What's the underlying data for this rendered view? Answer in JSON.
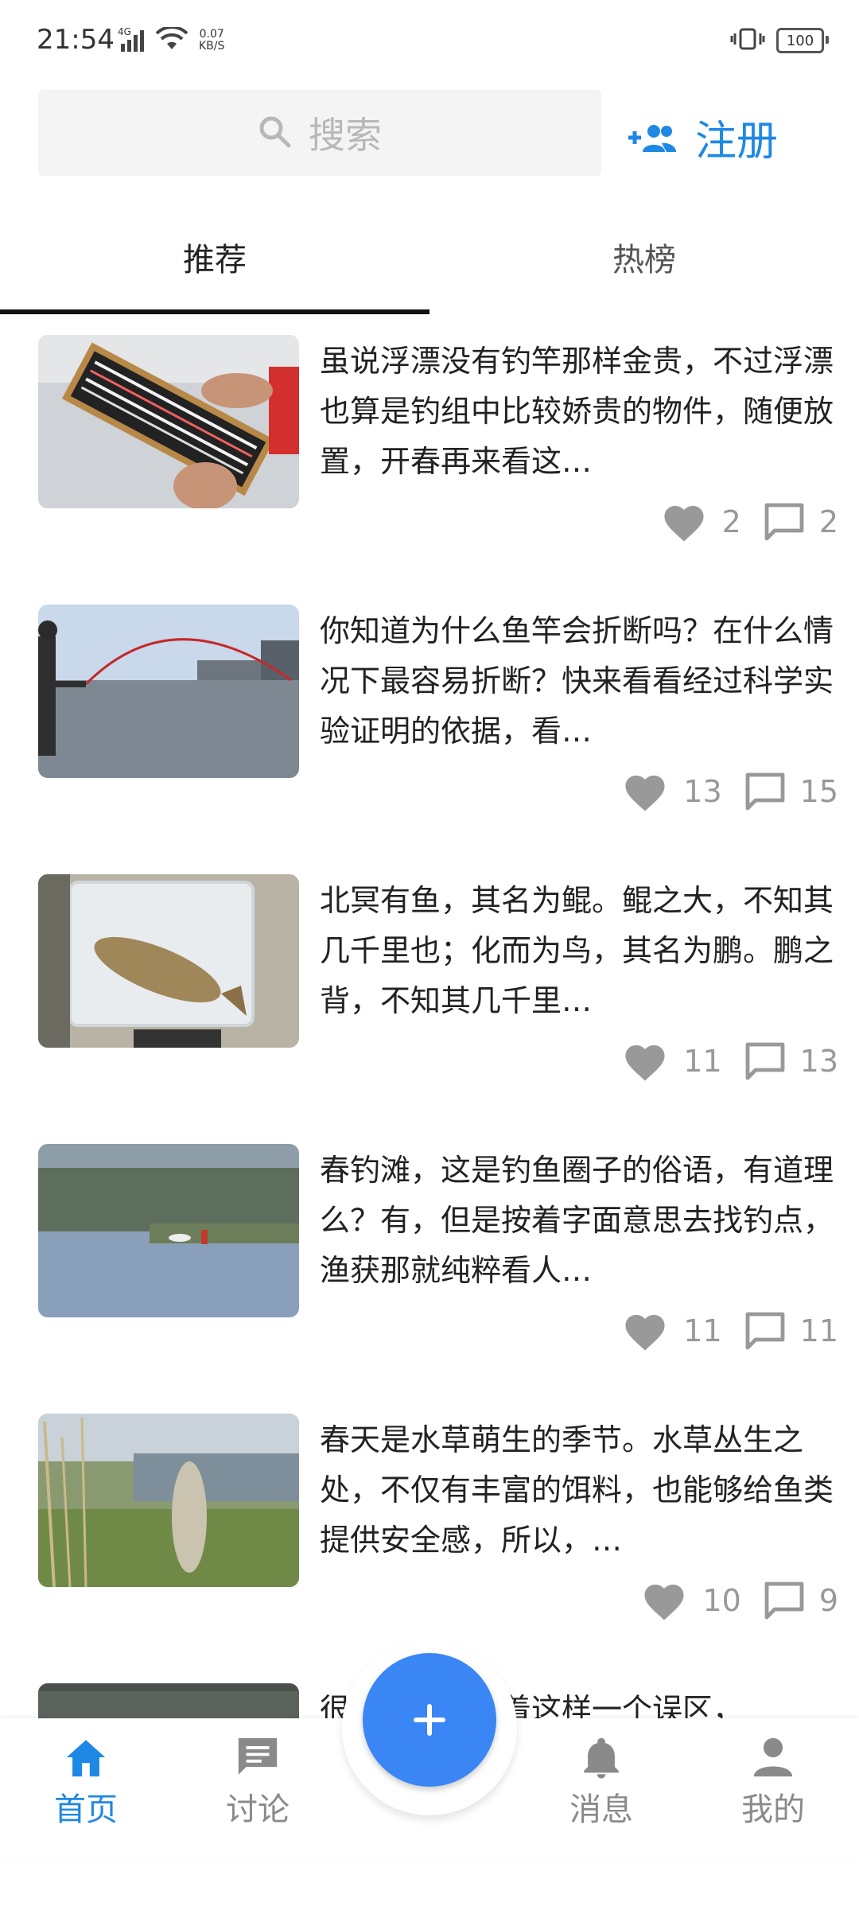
{
  "status_bar": {
    "time": "21:54",
    "network_type": "4G",
    "speed_value": "0.07",
    "speed_unit": "KB/S",
    "battery": "100"
  },
  "header": {
    "search_placeholder": "搜索",
    "register_label": "注册"
  },
  "tabs": [
    {
      "label": "推荐",
      "active": true
    },
    {
      "label": "热榜",
      "active": false
    }
  ],
  "articles": [
    {
      "text": "虽说浮漂没有钓竿那样金贵，不过浮漂也算是钓组中比较娇贵的物件，随便放置，开春再来看这…",
      "likes": "2",
      "comments": "2",
      "thumb_icon": "fishing-float-box-photo"
    },
    {
      "text": "你知道为什么鱼竿会折断吗？在什么情况下最容易折断？快来看看经过科学实验证明的依据，看…",
      "likes": "13",
      "comments": "15",
      "thumb_icon": "fishing-rod-river-photo"
    },
    {
      "text": "北冥有鱼，其名为鲲。鲲之大，不知其几千里也；化而为鸟，其名为鹏。鹏之背，不知其几千里…",
      "likes": "11",
      "comments": "13",
      "thumb_icon": "carp-in-bucket-photo"
    },
    {
      "text": "春钓滩，这是钓鱼圈子的俗语，有道理么？有，但是按着字面意思去找钓点，渔获那就纯粹看人…",
      "likes": "11",
      "comments": "11",
      "thumb_icon": "lake-angler-photo"
    },
    {
      "text": "春天是水草萌生的季节。水草丛生之处，不仅有丰富的饵料，也能够给鱼类提供安全感，所以，…",
      "likes": "10",
      "comments": "9",
      "thumb_icon": "fish-on-line-photo"
    },
    {
      "text": "很多钓友都有着这样一个误区，",
      "thumb_icon": "water-photo"
    }
  ],
  "bottom_nav": [
    {
      "label": "首页",
      "icon": "home-icon",
      "active": true
    },
    {
      "label": "讨论",
      "icon": "chat-icon",
      "active": false
    },
    {
      "label": "消息",
      "icon": "bell-icon",
      "active": false
    },
    {
      "label": "我的",
      "icon": "person-icon",
      "active": false
    }
  ],
  "colors": {
    "accent": "#1e88e5",
    "fab": "#3a86f5",
    "meta_gray": "#999999"
  }
}
